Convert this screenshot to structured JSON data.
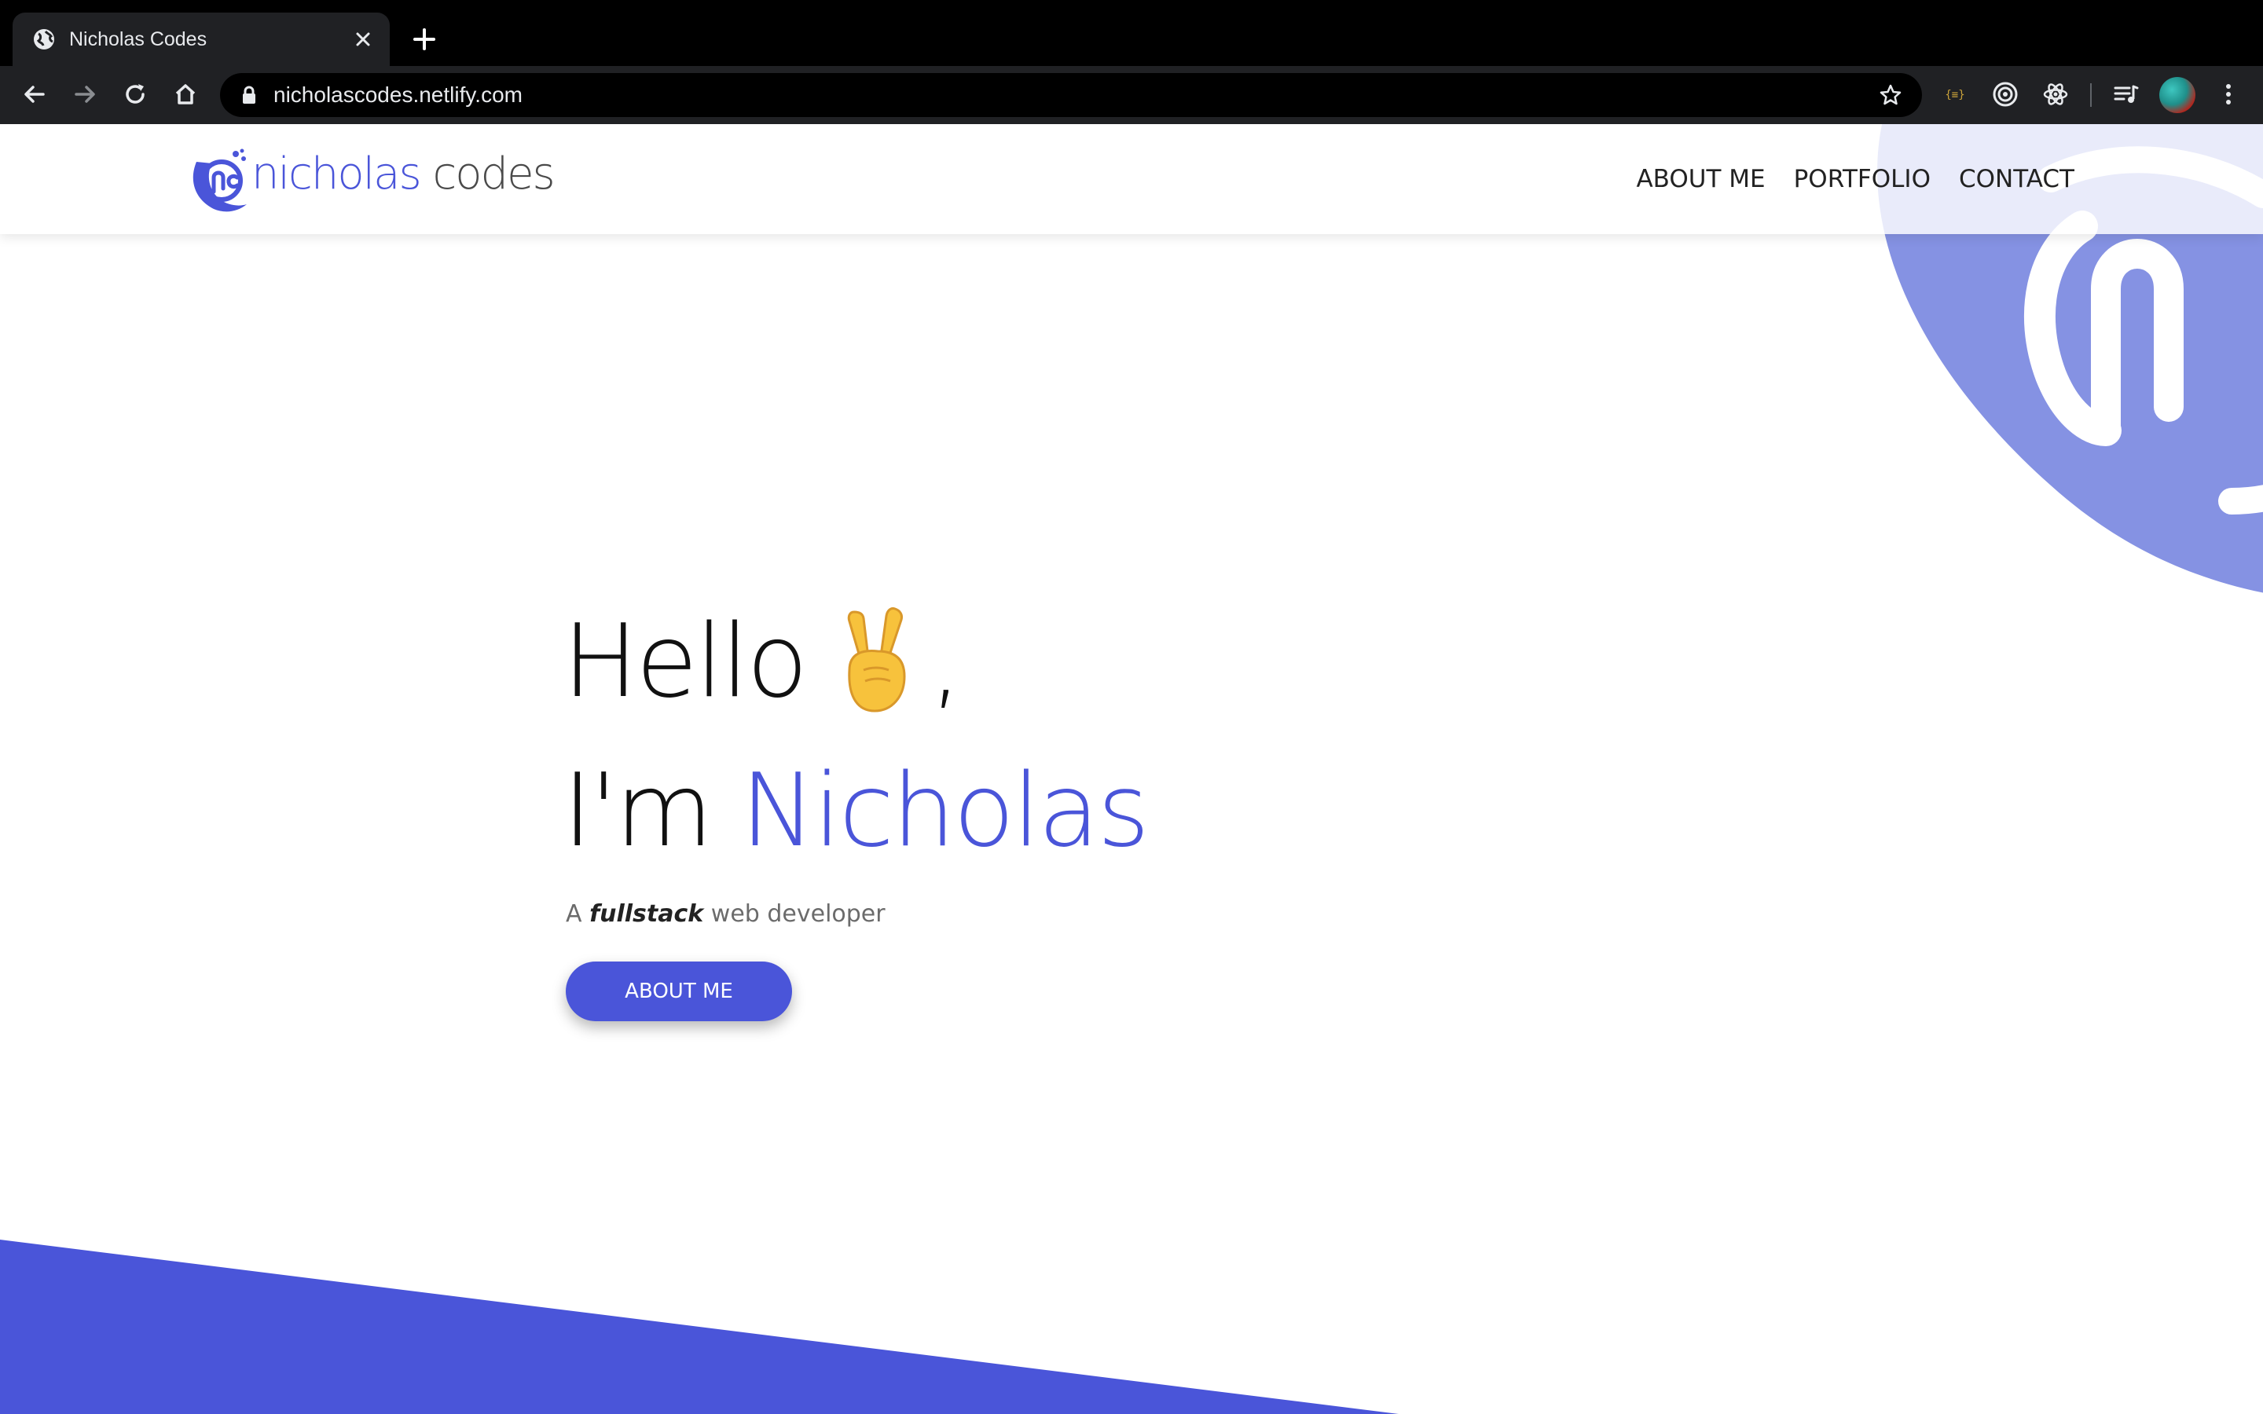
{
  "browser": {
    "tab_title": "Nicholas Codes",
    "url": "nicholascodes.netlify.com",
    "icons": {
      "favicon": "globe-icon",
      "close": "close-icon",
      "new_tab": "plus-icon",
      "back": "arrow-left-icon",
      "forward": "arrow-right-icon",
      "reload": "reload-icon",
      "home": "home-icon",
      "lock": "lock-icon",
      "bookmark": "star-icon",
      "extensions": [
        "json-viewer-icon",
        "target-icon",
        "react-devtools-icon",
        "media-queue-icon"
      ],
      "profile": "avatar",
      "menu": "kebab-menu-icon"
    }
  },
  "site": {
    "brand": {
      "part1": "nicholas",
      "part2": "codes"
    },
    "nav": [
      {
        "label": "ABOUT ME"
      },
      {
        "label": "PORTFOLIO"
      },
      {
        "label": "CONTACT"
      }
    ],
    "hero": {
      "greeting": "Hello",
      "comma": ",",
      "intro": "I'm",
      "name": "Nicholas",
      "tagline_prefix": "A",
      "tagline_emphasis": "fullstack",
      "tagline_suffix": "web developer",
      "cta_label": "ABOUT ME"
    }
  },
  "colors": {
    "accent": "#4a55d9",
    "accent_light": "#8592e3",
    "browser_dark": "#202124",
    "text": "#111111"
  }
}
